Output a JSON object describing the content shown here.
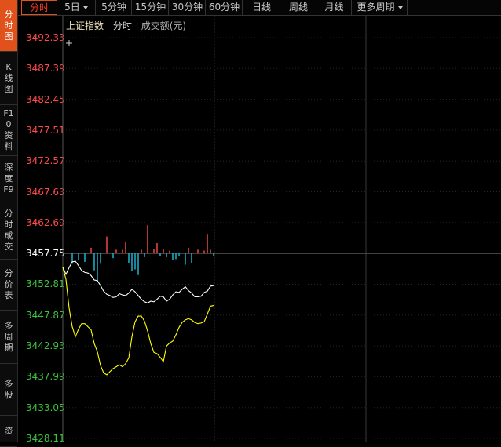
{
  "sidebar": {
    "tabs": [
      {
        "label": "分时图",
        "active": true
      },
      {
        "label": "K线图",
        "active": false
      },
      {
        "label": "F10资料",
        "active": false
      },
      {
        "label": "深度F9",
        "active": false
      },
      {
        "label": "分时成交",
        "active": false
      },
      {
        "label": "分价表",
        "active": false
      },
      {
        "label": "多周期",
        "active": false
      },
      {
        "label": "多股",
        "active": false
      },
      {
        "label": "资",
        "active": false
      }
    ]
  },
  "toolbar": {
    "buttons": [
      {
        "label": "分时",
        "active": true,
        "dropdown": false
      },
      {
        "label": "5日",
        "active": false,
        "dropdown": true
      },
      {
        "label": "5分钟",
        "active": false,
        "dropdown": false
      },
      {
        "label": "15分钟",
        "active": false,
        "dropdown": false
      },
      {
        "label": "30分钟",
        "active": false,
        "dropdown": false
      },
      {
        "label": "60分钟",
        "active": false,
        "dropdown": false
      },
      {
        "label": "日线",
        "active": false,
        "dropdown": false
      },
      {
        "label": "周线",
        "active": false,
        "dropdown": false
      },
      {
        "label": "月线",
        "active": false,
        "dropdown": false
      },
      {
        "label": "更多周期",
        "active": false,
        "dropdown": true
      }
    ]
  },
  "header": {
    "index_name": "上证指数",
    "mode": "分时",
    "volume_label": "成交额(元)"
  },
  "colors": {
    "up": "#ff4a4a",
    "down": "#3cc33c",
    "neutral": "#ffffff",
    "price_line": "#ffffff",
    "avg_line": "#ffff00",
    "vol_down": "#20c0e0",
    "active_tab": "#e0511c"
  },
  "chart_data": {
    "type": "line",
    "reference_price": 3457.75,
    "y_ticks": [
      "3492.33",
      "3487.39",
      "3482.45",
      "3477.51",
      "3472.57",
      "3467.63",
      "3462.69",
      "3457.75",
      "3452.81",
      "3447.87",
      "3442.93",
      "3437.99",
      "3433.05",
      "3428.11"
    ],
    "ylim": [
      3428.11,
      3492.33
    ],
    "x": [
      0,
      1,
      2,
      3,
      4,
      5,
      6,
      7,
      8,
      9,
      10,
      11,
      12,
      13,
      14,
      15,
      16,
      17,
      18,
      19,
      20,
      21,
      22,
      23,
      24,
      25,
      26,
      27,
      28,
      29,
      30,
      31,
      32,
      33,
      34,
      35,
      36,
      37,
      38,
      39,
      40,
      41,
      42,
      43,
      44,
      45,
      46,
      47,
      48
    ],
    "series": [
      {
        "values": [
          3455.6,
          3454.4,
          3455.5,
          3456.4,
          3456.5,
          3455.8,
          3455.0,
          3454.7,
          3454.6,
          3454.2,
          3453.5,
          3453.4,
          3452.6,
          3451.7,
          3451.2,
          3451.0,
          3450.7,
          3450.8,
          3451.3,
          3451.1,
          3451.0,
          3451.4,
          3452.0,
          3451.6,
          3451.0,
          3450.4,
          3450.0,
          3449.8,
          3450.1,
          3450.0,
          3450.4,
          3450.9,
          3450.8,
          3450.1,
          3450.4,
          3451.1,
          3451.6,
          3451.5,
          3452.0,
          3452.4,
          3451.8,
          3451.4,
          3450.8,
          3450.8,
          3450.9,
          3451.5,
          3451.7,
          3452.5,
          3452.6
        ]
      },
      {
        "values": [
          3455.5,
          3453.6,
          3449.0,
          3446.0,
          3444.4,
          3445.6,
          3446.5,
          3446.5,
          3446.0,
          3445.5,
          3443.3,
          3442.0,
          3439.8,
          3438.6,
          3438.3,
          3438.8,
          3439.3,
          3439.6,
          3439.9,
          3439.6,
          3440.1,
          3441.0,
          3444.4,
          3446.8,
          3447.7,
          3447.7,
          3446.9,
          3445.3,
          3443.3,
          3441.9,
          3441.7,
          3441.1,
          3440.4,
          3442.9,
          3443.4,
          3443.7,
          3444.7,
          3445.9,
          3446.7,
          3447.1,
          3447.3,
          3447.1,
          3446.7,
          3446.5,
          3446.6,
          3446.8,
          3448.0,
          3449.3,
          3449.4
        ]
      }
    ],
    "volume_bars": [
      {
        "x": 3,
        "dir": "down",
        "value": 0.55
      },
      {
        "x": 5,
        "dir": "down",
        "value": 0.35
      },
      {
        "x": 7,
        "dir": "down",
        "value": 0.45
      },
      {
        "x": 9,
        "dir": "up",
        "value": 0.3
      },
      {
        "x": 10,
        "dir": "down",
        "value": 0.9
      },
      {
        "x": 11,
        "dir": "down",
        "value": 1.5
      },
      {
        "x": 12,
        "dir": "down",
        "value": 0.55
      },
      {
        "x": 14,
        "dir": "up",
        "value": 0.9
      },
      {
        "x": 16,
        "dir": "down",
        "value": 0.25
      },
      {
        "x": 17,
        "dir": "up",
        "value": 0.2
      },
      {
        "x": 19,
        "dir": "up",
        "value": 0.2
      },
      {
        "x": 20,
        "dir": "up",
        "value": 0.6
      },
      {
        "x": 21,
        "dir": "down",
        "value": 0.5
      },
      {
        "x": 22,
        "dir": "down",
        "value": 0.95
      },
      {
        "x": 23,
        "dir": "down",
        "value": 0.85
      },
      {
        "x": 24,
        "dir": "down",
        "value": 1.15
      },
      {
        "x": 25,
        "dir": "up",
        "value": 0.2
      },
      {
        "x": 26,
        "dir": "down",
        "value": 0.2
      },
      {
        "x": 27,
        "dir": "up",
        "value": 1.5
      },
      {
        "x": 29,
        "dir": "up",
        "value": 0.25
      },
      {
        "x": 30,
        "dir": "up",
        "value": 0.55
      },
      {
        "x": 31,
        "dir": "down",
        "value": 0.15
      },
      {
        "x": 32,
        "dir": "up",
        "value": 0.25
      },
      {
        "x": 33,
        "dir": "down",
        "value": 0.2
      },
      {
        "x": 34,
        "dir": "up",
        "value": 0.15
      },
      {
        "x": 35,
        "dir": "down",
        "value": 0.35
      },
      {
        "x": 36,
        "dir": "down",
        "value": 0.3
      },
      {
        "x": 37,
        "dir": "down",
        "value": 0.15
      },
      {
        "x": 39,
        "dir": "down",
        "value": 0.6
      },
      {
        "x": 40,
        "dir": "up",
        "value": 0.3
      },
      {
        "x": 41,
        "dir": "down",
        "value": 0.5
      },
      {
        "x": 43,
        "dir": "up",
        "value": 0.2
      },
      {
        "x": 45,
        "dir": "up",
        "value": 0.15
      },
      {
        "x": 46,
        "dir": "up",
        "value": 1.0
      },
      {
        "x": 47,
        "dir": "up",
        "value": 0.2
      },
      {
        "x": 48,
        "dir": "down",
        "value": 0.15
      }
    ]
  }
}
